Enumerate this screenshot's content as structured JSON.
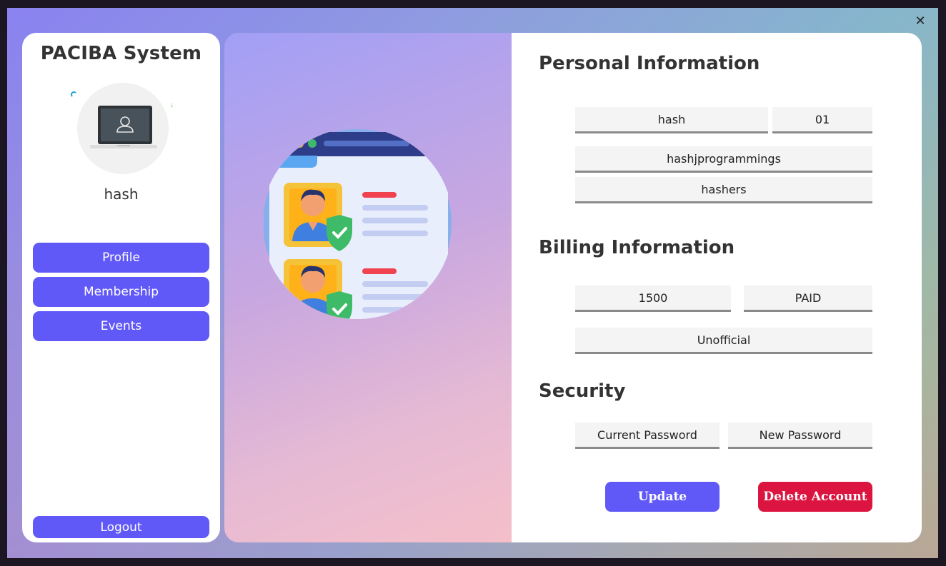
{
  "window": {
    "close_glyph": "✕"
  },
  "sidebar": {
    "app_title": "PACIBA System",
    "avatar_icon": "laptop-user-icon",
    "username": "hash",
    "nav": [
      {
        "label": "Profile"
      },
      {
        "label": "Membership"
      },
      {
        "label": "Events"
      }
    ],
    "logout_label": "Logout"
  },
  "illustration": {
    "icon": "user-profile-cards-verified-illustration"
  },
  "personal": {
    "title": "Personal Information",
    "first_field": "hash",
    "second_field": "01",
    "third_field": "hashjprogrammings",
    "fourth_field": "hashers"
  },
  "billing": {
    "title": "Billing Information",
    "amount": "1500",
    "status": "PAID",
    "type": "Unofficial"
  },
  "security": {
    "title": "Security",
    "current_password_placeholder": "Current Password",
    "new_password_placeholder": "New Password"
  },
  "actions": {
    "update_label": "Update",
    "delete_label": "Delete Account"
  },
  "colors": {
    "accent": "#6159f7",
    "danger": "#dc1440"
  }
}
